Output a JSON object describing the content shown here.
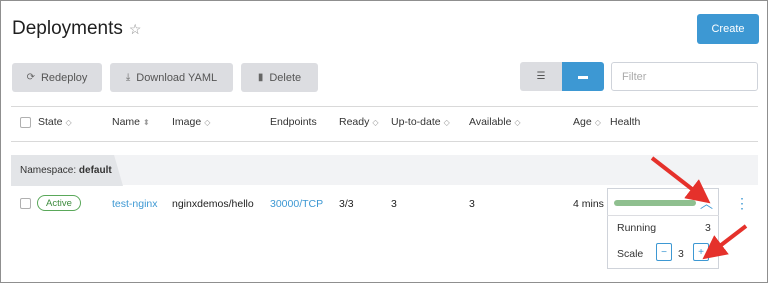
{
  "page": {
    "title": "Deployments"
  },
  "toolbar": {
    "create": "Create",
    "redeploy": "Redeploy",
    "download_yaml": "Download YAML",
    "delete": "Delete",
    "filter_placeholder": "Filter"
  },
  "table": {
    "headers": [
      "State",
      "Name",
      "Image",
      "Endpoints",
      "Ready",
      "Up-to-date",
      "Available",
      "Age",
      "Health"
    ],
    "namespace_prefix": "Namespace:",
    "namespace": "default",
    "row": {
      "state": "Active",
      "name": "test-nginx",
      "image": "nginxdemos/hello",
      "endpoints": "30000/TCP",
      "ready": "3/3",
      "up_to_date": "3",
      "available": "3",
      "age": "4 mins"
    }
  },
  "health": {
    "running_label": "Running",
    "running_value": "3",
    "scale_label": "Scale",
    "scale_value": "3",
    "minus": "−",
    "plus": "+"
  },
  "colors": {
    "accent": "#3d98d3",
    "annotation": "#e5312b",
    "status_active": "#5aa85a"
  }
}
